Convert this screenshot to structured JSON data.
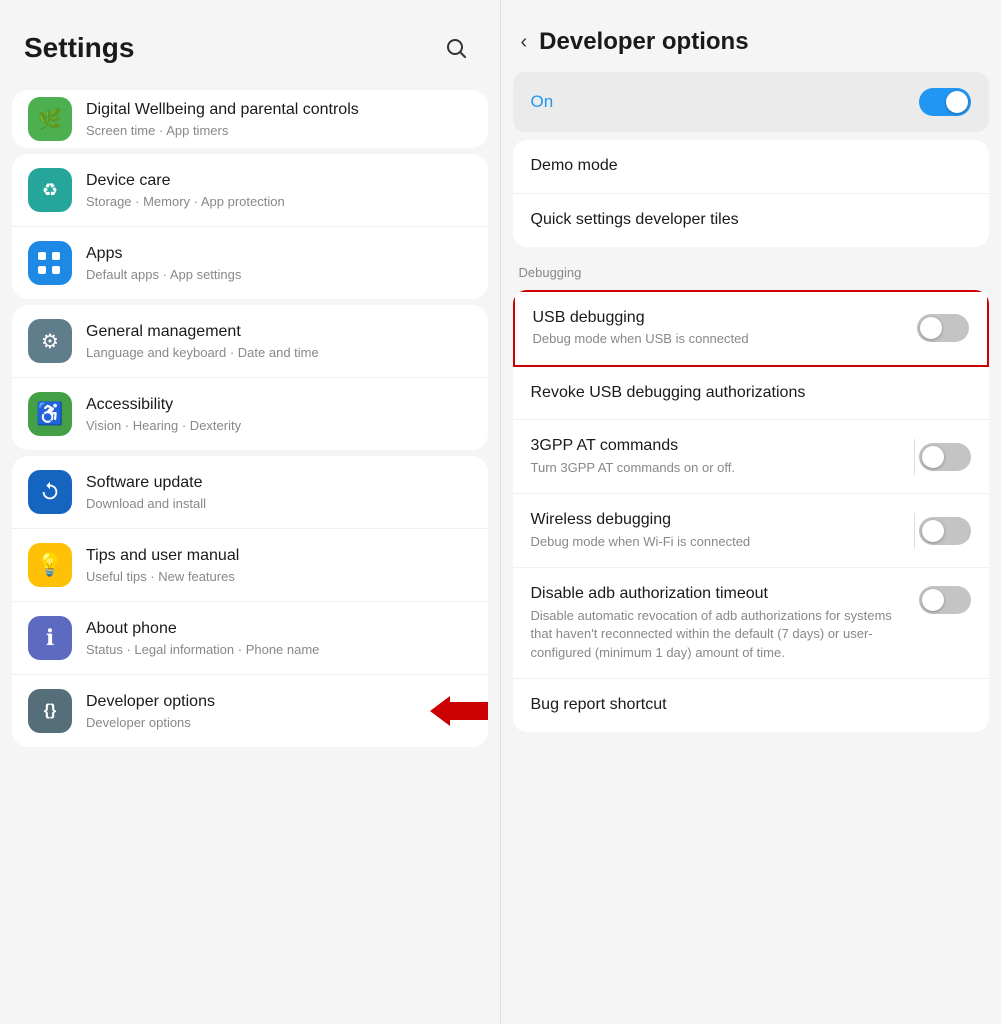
{
  "left": {
    "title": "Settings",
    "partial_item": {
      "title": "Digital Wellbeing and parental controls",
      "subtitle": "Screen time · App timers",
      "icon": "🟢",
      "icon_bg": "icon-green"
    },
    "groups": [
      {
        "items": [
          {
            "id": "device-care",
            "title": "Device care",
            "subtitle": "Storage · Memory · App protection",
            "icon": "♻",
            "icon_bg": "icon-teal"
          },
          {
            "id": "apps",
            "title": "Apps",
            "subtitle": "Default apps · App settings",
            "icon": "⠿",
            "icon_bg": "icon-blue-dots"
          }
        ]
      },
      {
        "items": [
          {
            "id": "general-management",
            "title": "General management",
            "subtitle": "Language and keyboard · Date and time",
            "icon": "≡",
            "icon_bg": "icon-gray-sliders"
          },
          {
            "id": "accessibility",
            "title": "Accessibility",
            "subtitle": "Vision · Hearing · Dexterity",
            "icon": "♿",
            "icon_bg": "icon-green-person"
          }
        ]
      },
      {
        "items": [
          {
            "id": "software-update",
            "title": "Software update",
            "subtitle": "Download and install",
            "icon": "↻",
            "icon_bg": "icon-blue-update"
          },
          {
            "id": "tips",
            "title": "Tips and user manual",
            "subtitle": "Useful tips · New features",
            "icon": "💡",
            "icon_bg": "icon-yellow-bulb"
          },
          {
            "id": "about-phone",
            "title": "About phone",
            "subtitle": "Status · Legal information · Phone name",
            "icon": "ℹ",
            "icon_bg": "icon-blue-info"
          },
          {
            "id": "developer-options",
            "title": "Developer options",
            "subtitle": "Developer options",
            "icon": "{}",
            "icon_bg": "icon-gray-dev",
            "has_red_arrow": true
          }
        ]
      }
    ]
  },
  "right": {
    "back_label": "‹",
    "title": "Developer options",
    "on_toggle": {
      "label": "On",
      "state": "on"
    },
    "items": [
      {
        "id": "demo-mode",
        "title": "Demo mode",
        "subtitle": "",
        "has_toggle": false
      },
      {
        "id": "quick-settings-dev-tiles",
        "title": "Quick settings developer tiles",
        "subtitle": "",
        "has_toggle": false
      }
    ],
    "debugging_section_label": "Debugging",
    "debugging_items": [
      {
        "id": "usb-debugging",
        "title": "USB debugging",
        "subtitle": "Debug mode when USB is connected",
        "has_toggle": true,
        "toggle_state": "off",
        "highlighted": true
      },
      {
        "id": "revoke-usb",
        "title": "Revoke USB debugging authorizations",
        "subtitle": "",
        "has_toggle": false
      },
      {
        "id": "3gpp-commands",
        "title": "3GPP AT commands",
        "subtitle": "Turn 3GPP AT commands on or off.",
        "has_toggle": true,
        "toggle_state": "off"
      },
      {
        "id": "wireless-debugging",
        "title": "Wireless debugging",
        "subtitle": "Debug mode when Wi-Fi is connected",
        "has_toggle": true,
        "toggle_state": "off"
      },
      {
        "id": "disable-adb-timeout",
        "title": "Disable adb authorization timeout",
        "subtitle": "Disable automatic revocation of adb authorizations for systems that haven't reconnected within the default (7 days) or user-configured (minimum 1 day) amount of time.",
        "has_toggle": true,
        "toggle_state": "off"
      },
      {
        "id": "bug-report-shortcut",
        "title": "Bug report shortcut",
        "subtitle": "",
        "has_toggle": false
      }
    ]
  }
}
